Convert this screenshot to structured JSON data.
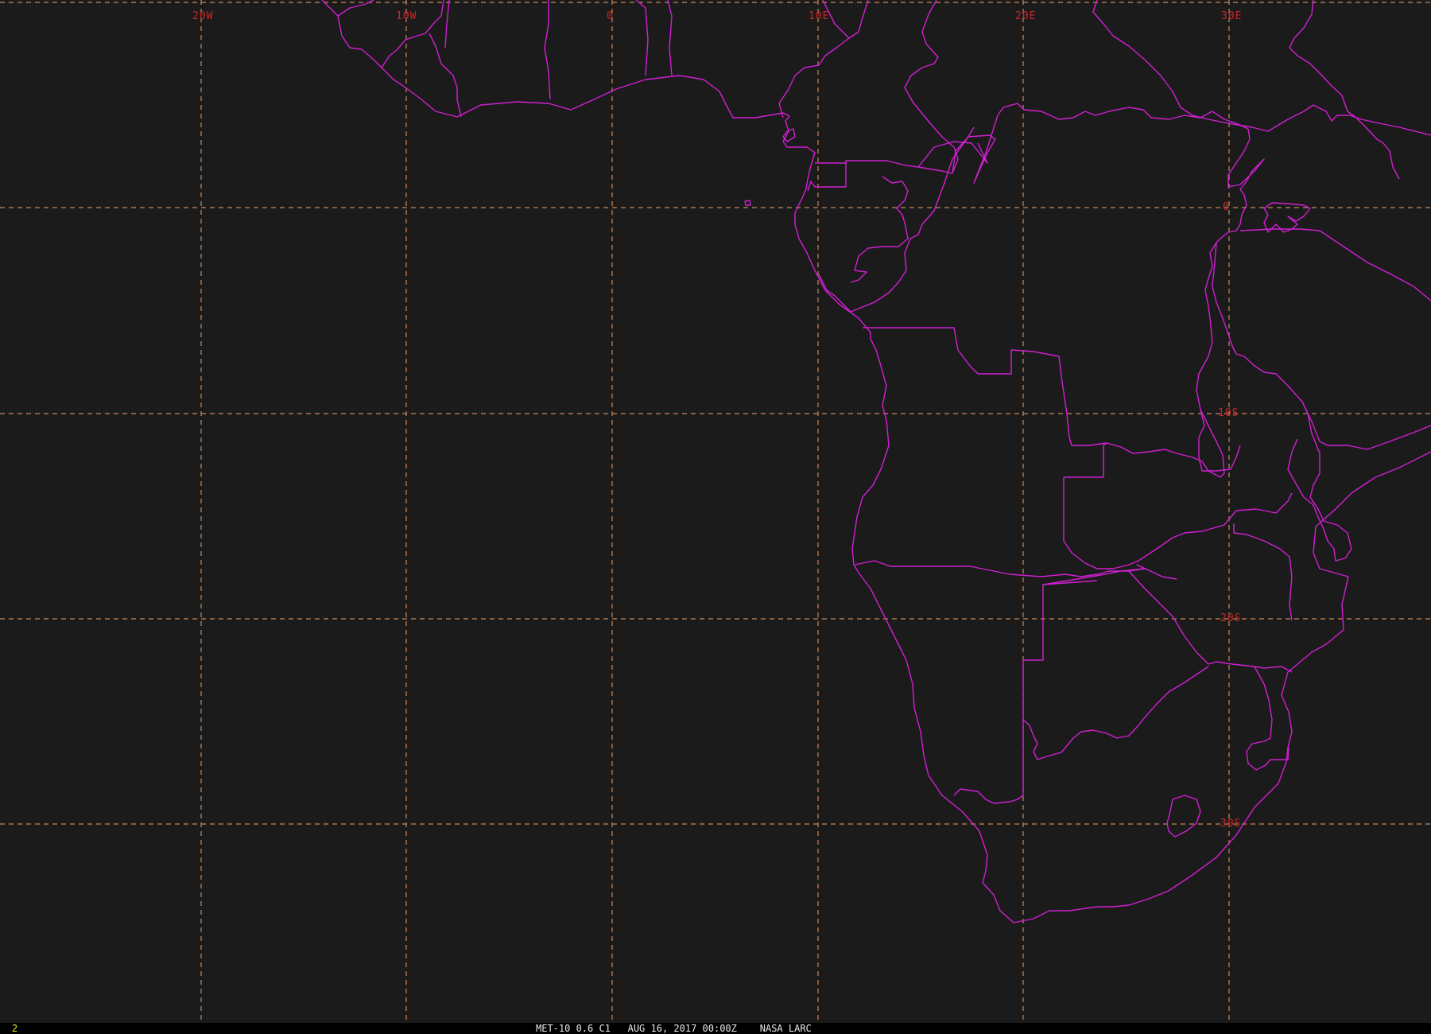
{
  "map": {
    "longitude_labels": [
      "20W",
      "10W",
      "0",
      "10E",
      "20E",
      "30E"
    ],
    "latitude_labels": [
      "0",
      "10S",
      "20S",
      "30S"
    ],
    "colors": {
      "background": "#1b1b1b",
      "grid": "#c8895a",
      "grid_labels": "#c82828",
      "borders": "#d21fd2"
    }
  },
  "status": {
    "frame": "2",
    "caption": "MET-10 0.6 C1   AUG 16, 2017 00:00Z    NASA LARC"
  }
}
